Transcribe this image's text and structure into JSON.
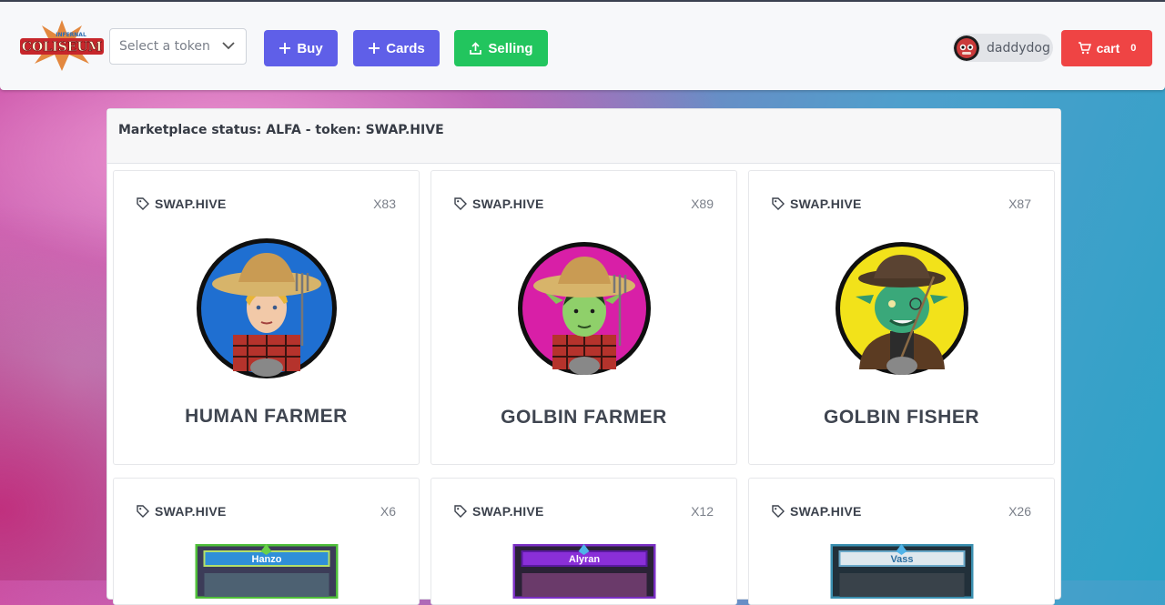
{
  "header": {
    "logo_text": "COLISEUM",
    "logo_subtext": "INFERNAL",
    "token_select": {
      "placeholder": "Select a token"
    },
    "buttons": {
      "buy": "Buy",
      "cards": "Cards",
      "selling": "Selling",
      "cart": "cart",
      "cart_count": "0"
    },
    "user": {
      "name": "daddydog"
    }
  },
  "panel": {
    "status": "Marketplace status: ALFA - token: SWAP.HIVE"
  },
  "cards": [
    {
      "token": "SWAP.HIVE",
      "qty": "X83",
      "name": "HUMAN FARMER",
      "bg": "#1f6fd1"
    },
    {
      "token": "SWAP.HIVE",
      "qty": "X89",
      "name": "GOLBIN FARMER",
      "bg": "#d81fa7"
    },
    {
      "token": "SWAP.HIVE",
      "qty": "X87",
      "name": "GOLBIN FISHER",
      "bg": "#f2e21a"
    },
    {
      "token": "SWAP.HIVE",
      "qty": "X6",
      "name": "Hanzo",
      "frame": "#4fbf3a"
    },
    {
      "token": "SWAP.HIVE",
      "qty": "X12",
      "name": "Alyran",
      "frame": "#7a2fc4"
    },
    {
      "token": "SWAP.HIVE",
      "qty": "X26",
      "name": "Vass",
      "frame": "#3a8fb0"
    }
  ],
  "colors": {
    "primary": "#5f5fe8",
    "success": "#22c55e",
    "danger": "#ef4444"
  }
}
